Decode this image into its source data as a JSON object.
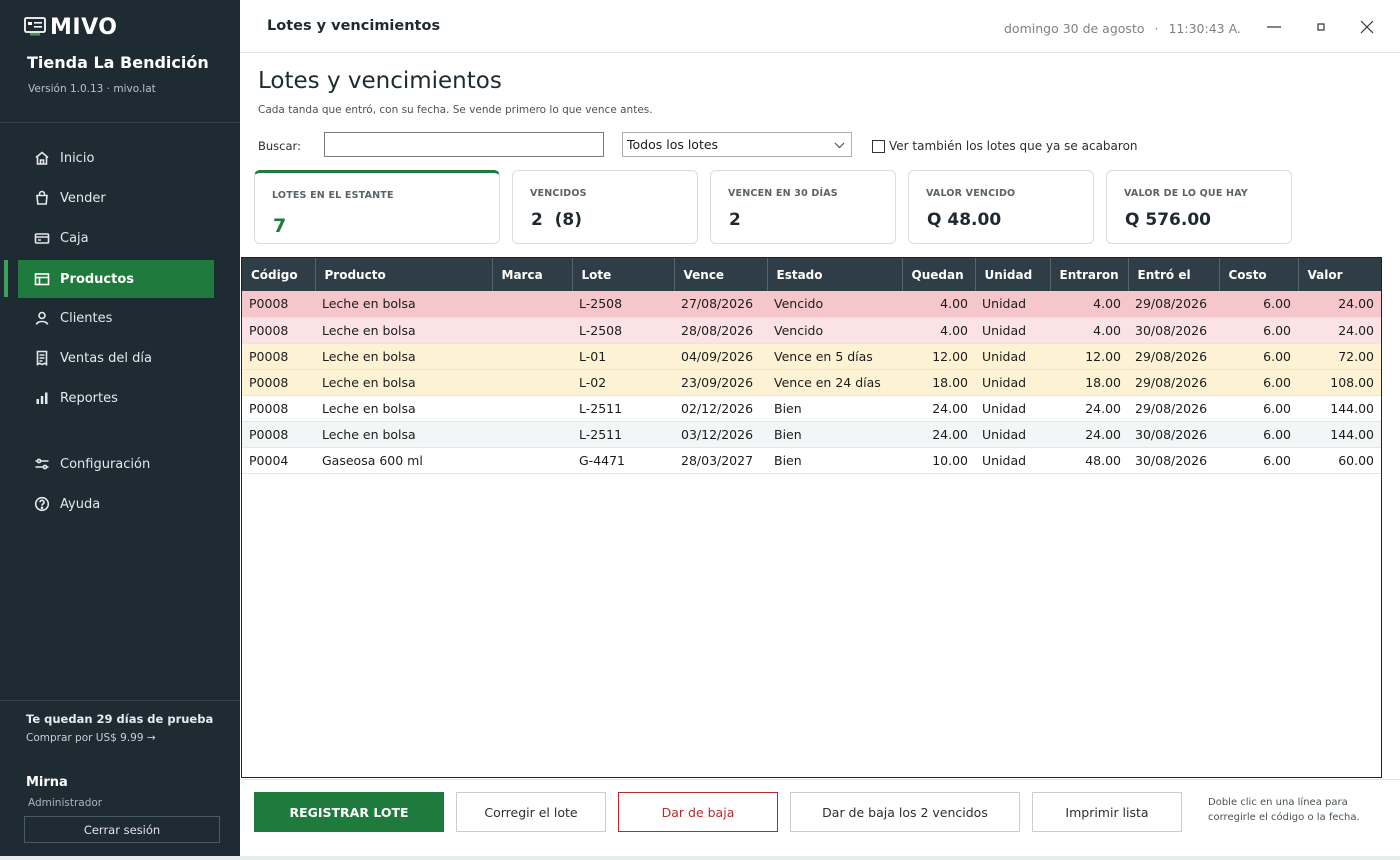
{
  "sidebar": {
    "brand": "MIVO",
    "store_name": "Tienda La Bendición",
    "version": "Versión 1.0.13 · mivo.lat",
    "nav": [
      {
        "label": "Inicio",
        "icon": "home-icon"
      },
      {
        "label": "Vender",
        "icon": "shopping-bag-icon"
      },
      {
        "label": "Caja",
        "icon": "cash-register-icon"
      },
      {
        "label": "Productos",
        "icon": "products-icon",
        "active": true
      },
      {
        "label": "Clientes",
        "icon": "user-icon"
      },
      {
        "label": "Ventas del día",
        "icon": "receipt-icon"
      },
      {
        "label": "Reportes",
        "icon": "bar-chart-icon"
      },
      {
        "label": "Configuración",
        "icon": "sliders-icon"
      },
      {
        "label": "Ayuda",
        "icon": "help-icon"
      }
    ],
    "trial_text": "Te quedan 29 días de prueba",
    "buy_link": "Comprar por US$ 9.99 →",
    "user_name": "Mirna",
    "user_role": "Administrador",
    "logout_label": "Cerrar sesión"
  },
  "titlebar": {
    "title": "Lotes y vencimientos",
    "date": "domingo 30 de agosto",
    "separator": "·",
    "time": "11:30:43 A."
  },
  "page": {
    "title": "Lotes y vencimientos",
    "subtitle": "Cada tanda que entró, con su fecha. Se vende primero lo que vence antes."
  },
  "filters": {
    "search_label": "Buscar:",
    "search_value": "",
    "lot_filter_selected": "Todos los lotes",
    "show_finished_label": "Ver también los lotes que ya se acabaron",
    "show_finished_checked": false
  },
  "cards": [
    {
      "label": "LOTES EN EL ESTANTE",
      "value": "7"
    },
    {
      "label": "VENCIDOS",
      "value": "2  (8)"
    },
    {
      "label": "VENCEN EN 30 DÍAS",
      "value": "2"
    },
    {
      "label": "VALOR VENCIDO",
      "value": "Q 48.00"
    },
    {
      "label": "VALOR DE LO QUE HAY",
      "value": "Q 576.00"
    }
  ],
  "table": {
    "columns": [
      "Código",
      "Producto",
      "Marca",
      "Lote",
      "Vence",
      "Estado",
      "Quedan",
      "Unidad",
      "Entraron",
      "Entró el",
      "Costo",
      "Valor"
    ],
    "rows": [
      {
        "status": "expired-1",
        "cells": [
          "P0008",
          "Leche en bolsa",
          "",
          "L-2508",
          "27/08/2026",
          "Vencido",
          "4.00",
          "Unidad",
          "4.00",
          "29/08/2026",
          "6.00",
          "24.00"
        ]
      },
      {
        "status": "expired-2",
        "cells": [
          "P0008",
          "Leche en bolsa",
          "",
          "L-2508",
          "28/08/2026",
          "Vencido",
          "4.00",
          "Unidad",
          "4.00",
          "30/08/2026",
          "6.00",
          "24.00"
        ]
      },
      {
        "status": "soon",
        "cells": [
          "P0008",
          "Leche en bolsa",
          "",
          "L-01",
          "04/09/2026",
          "Vence en 5 días",
          "12.00",
          "Unidad",
          "12.00",
          "29/08/2026",
          "6.00",
          "72.00"
        ]
      },
      {
        "status": "soon",
        "cells": [
          "P0008",
          "Leche en bolsa",
          "",
          "L-02",
          "23/09/2026",
          "Vence en 24 días",
          "18.00",
          "Unidad",
          "18.00",
          "29/08/2026",
          "6.00",
          "108.00"
        ]
      },
      {
        "status": "ok",
        "cells": [
          "P0008",
          "Leche en bolsa",
          "",
          "L-2511",
          "02/12/2026",
          "Bien",
          "24.00",
          "Unidad",
          "24.00",
          "29/08/2026",
          "6.00",
          "144.00"
        ]
      },
      {
        "status": "ok alt",
        "cells": [
          "P0008",
          "Leche en bolsa",
          "",
          "L-2511",
          "03/12/2026",
          "Bien",
          "24.00",
          "Unidad",
          "24.00",
          "30/08/2026",
          "6.00",
          "144.00"
        ]
      },
      {
        "status": "ok",
        "cells": [
          "P0004",
          "Gaseosa 600 ml",
          "",
          "G-4471",
          "28/03/2027",
          "Bien",
          "10.00",
          "Unidad",
          "48.00",
          "30/08/2026",
          "6.00",
          "60.00"
        ]
      }
    ]
  },
  "footer": {
    "register_label": "REGISTRAR LOTE",
    "correct_label": "Corregir el lote",
    "discard_label": "Dar de baja",
    "discard_expired_label": "Dar de baja los 2 vencidos",
    "print_label": "Imprimir lista",
    "hint": "Doble clic en una línea para corregirle el código o la fecha."
  },
  "colors": {
    "sidebar_bg": "#1f2b33",
    "accent_green": "#1f7a3d",
    "header_bg": "#2e3d46",
    "expired_row": "#f5c7ca",
    "expired_row_light": "#fbe3e5",
    "soon_row": "#fdf2d4",
    "danger": "#b82a2a"
  }
}
